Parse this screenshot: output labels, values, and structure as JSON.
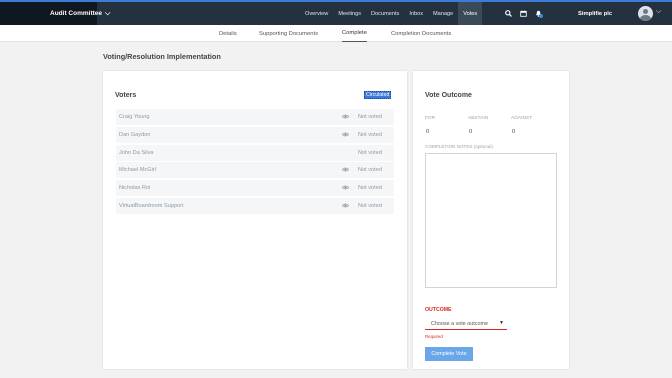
{
  "header": {
    "committee": "Audit Committee",
    "nav": [
      "Overview",
      "Meetings",
      "Documents",
      "Inbox",
      "Manage",
      "Votes"
    ],
    "active_nav": "Votes",
    "icons": [
      "search-icon",
      "calendar-icon",
      "notifications-bell-icon"
    ],
    "organization": "Simplifie plc"
  },
  "subnav": {
    "tabs": [
      "Details",
      "Supporting Documents",
      "Complete",
      "Completion Documents"
    ],
    "active_tab": "Complete"
  },
  "page": {
    "title": "Voting/Resolution Implementation"
  },
  "voters": {
    "title": "Voters",
    "circulated_label": "Circulated",
    "rows": [
      {
        "name": "Craig Young",
        "eye": true,
        "status": "Not voted"
      },
      {
        "name": "Dan Gaydon",
        "eye": true,
        "status": "Not voted"
      },
      {
        "name": "John Da Silva",
        "eye": false,
        "status": "Not voted"
      },
      {
        "name": "Michael McGirl",
        "eye": true,
        "status": "Not voted"
      },
      {
        "name": "Nicholas Roi",
        "eye": true,
        "status": "Not voted"
      },
      {
        "name": "VirtualBoardroom Support",
        "eye": true,
        "status": "Not voted"
      }
    ]
  },
  "outcome": {
    "title": "Vote Outcome",
    "for_label": "FOR",
    "abstain_label": "ABSTAIN",
    "against_label": "AGAINST",
    "for_count": "0",
    "abstain_count": "0",
    "against_count": "0",
    "notes_label": "COMPLETION NOTES (optional)",
    "notes_value": "",
    "outcome_label": "OUTCOME",
    "select_value": "Choose a vote outcome",
    "required_text": "Required",
    "complete_button": "Complete Vote"
  },
  "colors": {
    "topbar": "#243240",
    "accent": "#3d7bd9",
    "error": "#d9281f",
    "button": "#6aa7e8"
  }
}
